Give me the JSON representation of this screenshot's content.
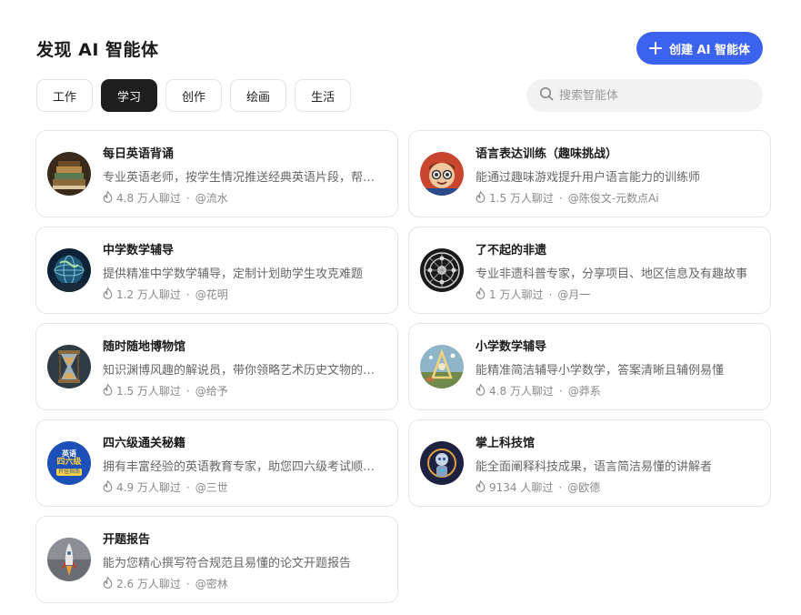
{
  "header": {
    "title": "发现 AI 智能体",
    "create_label": "创建 AI 智能体"
  },
  "tabs": [
    {
      "label": "工作",
      "active": false
    },
    {
      "label": "学习",
      "active": true
    },
    {
      "label": "创作",
      "active": false
    },
    {
      "label": "绘画",
      "active": false
    },
    {
      "label": "生活",
      "active": false
    }
  ],
  "search": {
    "placeholder": "搜索智能体",
    "value": ""
  },
  "colors": {
    "accent": "#3b63f0",
    "active_tab": "#1e1e1e",
    "search_bg": "#f2f2f3"
  },
  "agents": [
    {
      "title": "每日英语背诵",
      "desc": "专业英语老师，按学生情况推送经典英语片段，帮助学生背诵",
      "chats": "4.8 万人聊过",
      "author": "@流水",
      "icon": "books-avatar"
    },
    {
      "title": "语言表达训练（趣味挑战）",
      "desc": "能通过趣味游戏提升用户语言能力的训练师",
      "chats": "1.5 万人聊过",
      "author": "@陈俊文-元数点Ai",
      "icon": "cartoon-boy-avatar"
    },
    {
      "title": "中学数学辅导",
      "desc": "提供精准中学数学辅导，定制计划助学生攻克难题",
      "chats": "1.2 万人聊过",
      "author": "@花明",
      "icon": "globe-avatar"
    },
    {
      "title": "了不起的非遗",
      "desc": "专业非遗科普专家，分享项目、地区信息及有趣故事",
      "chats": "1 万人聊过",
      "author": "@月一",
      "icon": "pattern-avatar"
    },
    {
      "title": "随时随地博物馆",
      "desc": "知识渊博风趣的解说员，带你领略艺术历史文物的魅力",
      "chats": "1.5 万人聊过",
      "author": "@给予",
      "icon": "hourglass-avatar"
    },
    {
      "title": "小学数学辅导",
      "desc": "能精准简洁辅导小学数学，答案清晰且辅例易懂",
      "chats": "4.8 万人聊过",
      "author": "@莽系",
      "icon": "fantasy-avatar"
    },
    {
      "title": "四六级通关秘籍",
      "desc": "拥有丰富经验的英语教育专家，助您四六级考试顺利通关",
      "chats": "4.9 万人聊过",
      "author": "@三世",
      "icon": "cet-guide-avatar",
      "badge_lines": [
        "英语",
        "四六级",
        "开挂指南"
      ]
    },
    {
      "title": "掌上科技馆",
      "desc": "能全面阐释科技成果，语言简洁易懂的讲解者",
      "chats": "9134 人聊过",
      "author": "@欧德",
      "icon": "robot-avatar"
    },
    {
      "title": "开题报告",
      "desc": "能为您精心撰写符合规范且易懂的论文开题报告",
      "chats": "2.6 万人聊过",
      "author": "@密林",
      "icon": "rocket-avatar"
    }
  ]
}
